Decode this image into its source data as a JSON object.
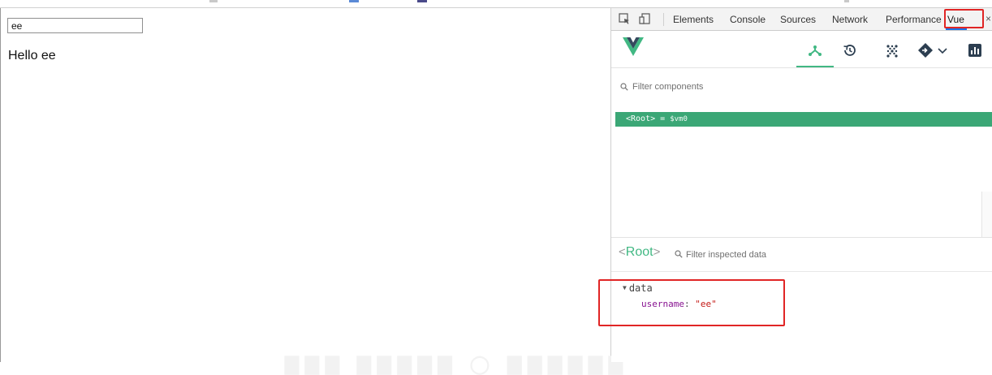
{
  "page": {
    "input_value": "ee",
    "greeting": "Hello ee"
  },
  "devtools": {
    "tabs": [
      {
        "label": "Elements"
      },
      {
        "label": "Console"
      },
      {
        "label": "Sources"
      },
      {
        "label": "Network"
      },
      {
        "label": "Performance"
      },
      {
        "label": "Vue",
        "active": true
      }
    ],
    "close_glyph": "×",
    "icons": [
      "inspect-element-icon",
      "device-toggle-icon"
    ]
  },
  "vue_panel": {
    "toolbar_icons": [
      "components-tree-icon",
      "history-icon",
      "vuex-icon",
      "events-icon",
      "chevron-down-icon",
      "performance-icon"
    ],
    "components_filter_placeholder": "Filter components",
    "root_component": {
      "label": "<Root>",
      "separator": " = ",
      "vm_ref": "$vm0"
    },
    "inspector": {
      "component_name_open": "<",
      "component_name": "Root",
      "component_name_close": ">",
      "filter_placeholder": "Filter inspected data",
      "section_label": "data",
      "properties": [
        {
          "key": "username",
          "value": "\"ee\""
        }
      ]
    }
  },
  "colors": {
    "vue_green": "#41b883",
    "root_row_bg": "#3ba776",
    "highlight_red": "#e02525",
    "tab_active_underline": "#1a73e8",
    "prop_key": "#881391",
    "prop_string": "#c41a16"
  }
}
